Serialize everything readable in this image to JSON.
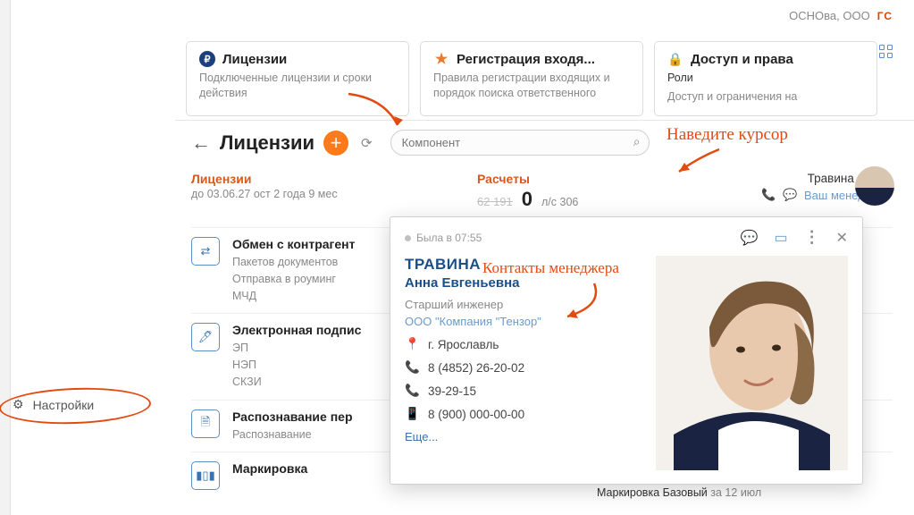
{
  "org": {
    "name": "ОСНОва, ООО",
    "logo": "ГС"
  },
  "cards": {
    "licenses": {
      "title": "Лицензии",
      "desc": "Подключенные лицензии и сроки действия"
    },
    "registration": {
      "title": "Регистрация входя...",
      "desc": "Правила регистрации входящих и порядок поиска ответственного"
    },
    "access": {
      "title": "Доступ и права",
      "sub_title": "Роли",
      "desc": "Доступ и ограничения на"
    }
  },
  "panel": {
    "title": "Лицензии",
    "search_placeholder": "Компонент"
  },
  "columns": {
    "licenses": {
      "head": "Лицензии",
      "sub": "до 03.06.27 ост 2 года 9 мес"
    },
    "calc": {
      "head": "Расчеты",
      "old": "62 191",
      "value": "0",
      "account": "л/с 306"
    },
    "manager": {
      "name": "Травина Анна",
      "role": "Ваш менеджер"
    }
  },
  "items": [
    {
      "title": "Обмен с контрагент",
      "tags": [
        "Пакетов документов",
        "Отправка в роуминг",
        "МЧД"
      ]
    },
    {
      "title": "Электронная подпис",
      "tags": [
        "ЭП",
        "НЭП",
        "СКЗИ"
      ]
    },
    {
      "title": "Распознавание пер",
      "tags": [
        "Распознавание"
      ]
    },
    {
      "title": "Маркировка",
      "tags": []
    }
  ],
  "settings": {
    "label": "Настройки"
  },
  "annotations": {
    "hover": "Наведите курсор",
    "contacts": "Контакты менеджера"
  },
  "popup": {
    "status": "Была в 07:55",
    "surname": "ТРАВИНА",
    "name": "Анна Евгеньевна",
    "role": "Старший инженер",
    "company": "ООО \"Компания \"Тензор\"",
    "city": "г. Ярославль",
    "phone1": "8 (4852) 26-20-02",
    "phone2": "39-29-15",
    "mobile": "8 (900) 000-00-00",
    "more": "Еще..."
  },
  "bottom": {
    "title": "Маркировка Базовый",
    "date": "за 12 июл"
  }
}
